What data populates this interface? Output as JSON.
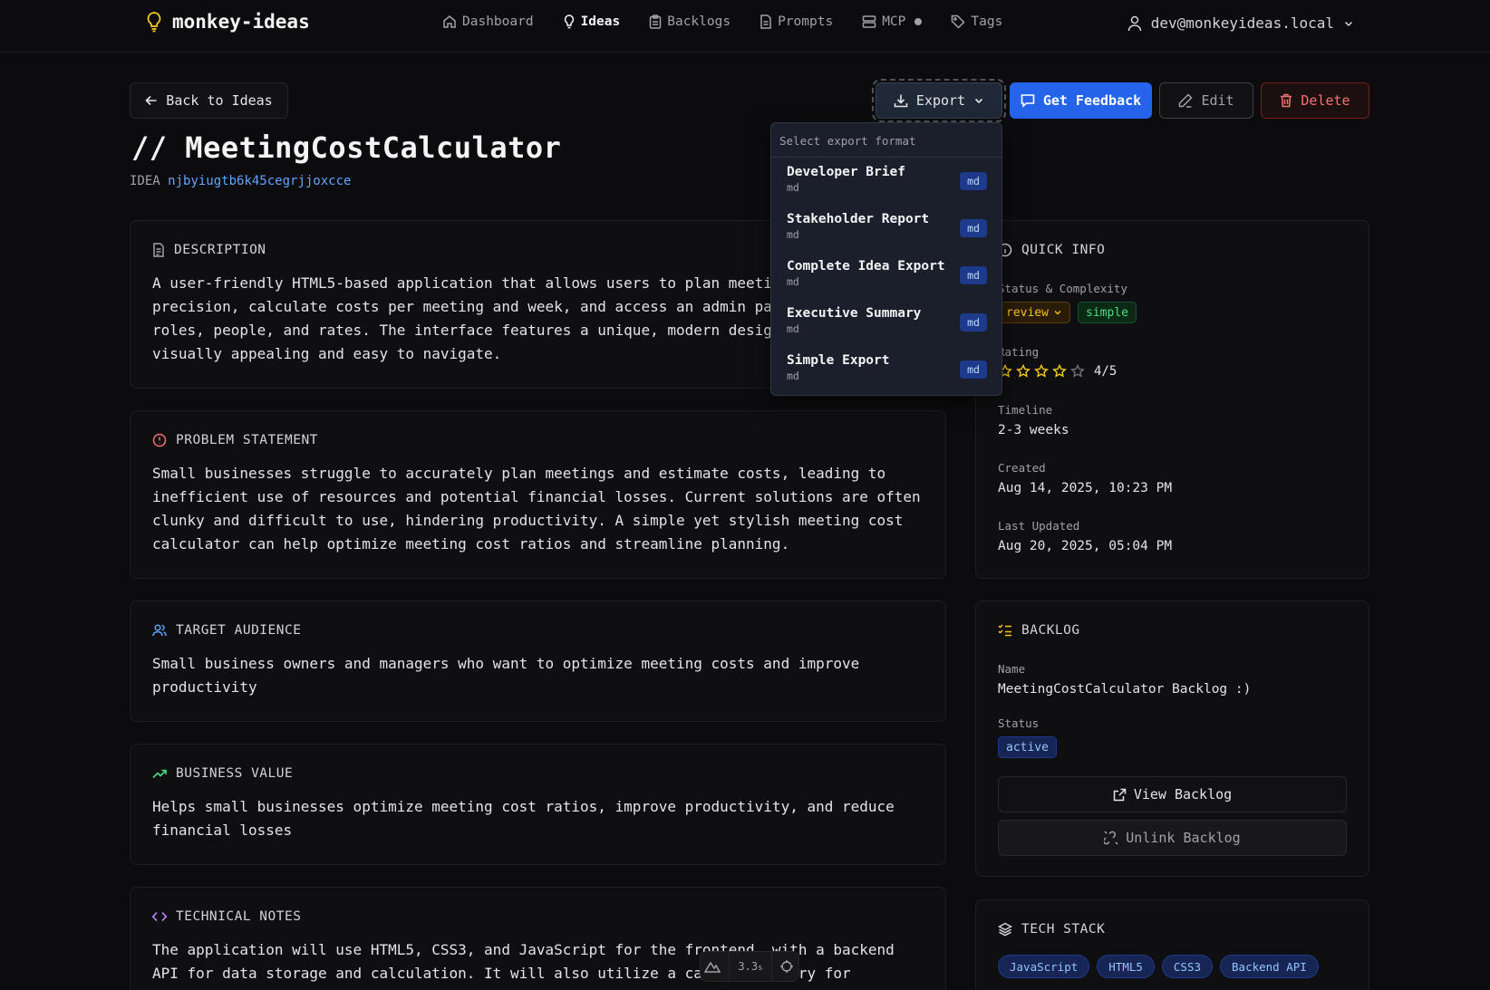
{
  "brand": {
    "name": "monkey-ideas",
    "icon": "lightbulb-icon"
  },
  "nav": {
    "items": [
      {
        "label": "Dashboard",
        "icon": "home-icon"
      },
      {
        "label": "Ideas",
        "icon": "lightbulb-icon",
        "active": true
      },
      {
        "label": "Backlogs",
        "icon": "clipboard-icon"
      },
      {
        "label": "Prompts",
        "icon": "file-icon"
      },
      {
        "label": "MCP",
        "icon": "server-icon"
      },
      {
        "label": "Tags",
        "icon": "tag-icon"
      }
    ],
    "user": "dev@monkeyideas.local"
  },
  "actions": {
    "back": "Back to Ideas",
    "export": "Export",
    "feedback": "Get Feedback",
    "edit": "Edit",
    "delete": "Delete"
  },
  "idea": {
    "title": "// MeetingCostCalculator",
    "id_label": "IDEA",
    "id": "njbyiugtb6k45cegrjjoxcce"
  },
  "export_menu": {
    "header": "Select export format",
    "items": [
      {
        "title": "Developer Brief",
        "sub": "md",
        "badge": "md"
      },
      {
        "title": "Stakeholder Report",
        "sub": "md",
        "badge": "md"
      },
      {
        "title": "Complete Idea Export",
        "sub": "md",
        "badge": "md"
      },
      {
        "title": "Executive Summary",
        "sub": "md",
        "badge": "md"
      },
      {
        "title": "Simple Export",
        "sub": "md",
        "badge": "md"
      }
    ]
  },
  "sections": {
    "description": {
      "title": "DESCRIPTION",
      "lines": [
        "A user-friendly HTML5-based application that allows users to plan meeti",
        "precision, calculate costs per meeting and week, and access an admin pa",
        "roles, people, and rates. The interface features a unique, modern desig",
        "visually appealing and easy to navigate."
      ]
    },
    "problem": {
      "title": "PROBLEM STATEMENT",
      "lines": [
        "Small businesses struggle to accurately plan meetings and estimate costs, leading to",
        "inefficient use of resources and potential financial losses. Current solutions are often",
        "clunky and difficult to use, hindering productivity. A simple yet stylish meeting cost",
        "calculator can help optimize meeting cost ratios and streamline planning."
      ]
    },
    "audience": {
      "title": "TARGET AUDIENCE",
      "lines": [
        "Small business owners and managers who want to optimize meeting costs and improve",
        "productivity"
      ]
    },
    "value": {
      "title": "BUSINESS VALUE",
      "lines": [
        "Helps small businesses optimize meeting cost ratios, improve productivity, and reduce",
        "financial losses"
      ]
    },
    "technical": {
      "title": "TECHNICAL NOTES",
      "lines": [
        "The application will use HTML5, CSS3, and JavaScript for the frontend, with a backend",
        "API for data storage and calculation. It will also utilize a ca          ary for"
      ]
    }
  },
  "quick_info": {
    "title": "QUICK INFO",
    "status_label": "Status & Complexity",
    "status": "review",
    "complexity": "simple",
    "rating_label": "Rating",
    "rating": 4,
    "rating_max": 5,
    "rating_text": "4/5",
    "timeline_label": "Timeline",
    "timeline": "2-3 weeks",
    "created_label": "Created",
    "created": "Aug 14, 2025, 10:23 PM",
    "updated_label": "Last Updated",
    "updated": "Aug 20, 2025, 05:04 PM"
  },
  "backlog": {
    "title": "BACKLOG",
    "name_label": "Name",
    "name": "MeetingCostCalculator Backlog :)",
    "status_label": "Status",
    "status": "active",
    "view": "View Backlog",
    "unlink": "Unlink Backlog"
  },
  "tech_stack": {
    "title": "TECH STACK",
    "items": [
      "JavaScript",
      "HTML5",
      "CSS3",
      "Backend API"
    ]
  },
  "overlay": {
    "time": "3.3",
    "unit": "s"
  },
  "colors": {
    "accent": "#2563eb",
    "danger": "#f87171",
    "link": "#60a5fa",
    "star": "#facc15"
  }
}
